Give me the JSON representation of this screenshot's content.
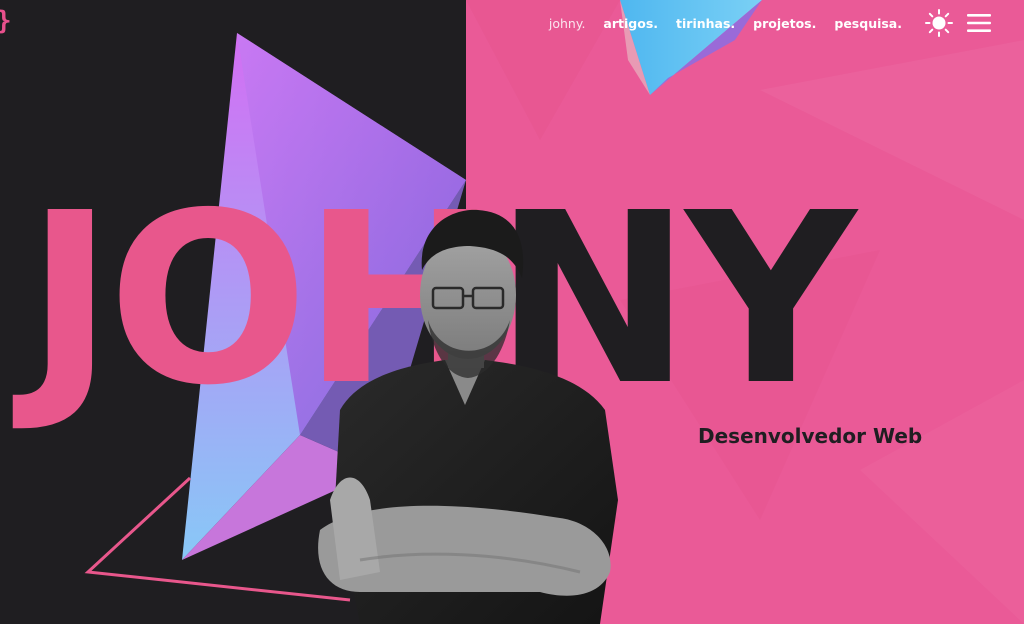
{
  "logo": {
    "text": "}"
  },
  "nav": {
    "links": [
      {
        "label": "johny.",
        "active": true
      },
      {
        "label": "artigos.",
        "active": false
      },
      {
        "label": "tirinhas.",
        "active": false
      },
      {
        "label": "projetos.",
        "active": false
      },
      {
        "label": "pesquisa.",
        "active": false
      }
    ],
    "theme_icon": "sun-icon",
    "menu_icon": "hamburger-menu-icon"
  },
  "hero": {
    "name": "JOHNY",
    "name_part1": "JOH",
    "name_part2": "NY",
    "subtitle": "Desenvolvedor Web",
    "photo": "portrait-photo"
  },
  "colors": {
    "dark": "#1f1e21",
    "pink": "#ea5a97",
    "name_pink": "#e8578c",
    "accent_blue": "#46b6ee",
    "accent_purple": "#c774f0"
  }
}
